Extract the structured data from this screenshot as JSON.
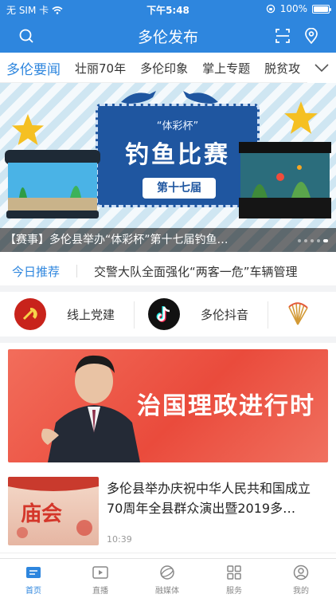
{
  "status_bar": {
    "carrier": "无 SIM 卡",
    "time": "下午5:48",
    "battery": "100%"
  },
  "header": {
    "title": "多伦发布"
  },
  "tabs": [
    {
      "label": "多伦要闻",
      "active": true
    },
    {
      "label": "壮丽70年"
    },
    {
      "label": "多伦印象"
    },
    {
      "label": "掌上专题"
    },
    {
      "label": "脱贫攻"
    }
  ],
  "banner": {
    "badge": "“体彩杯”",
    "headline": "钓鱼比赛",
    "edition": "第十七届",
    "caption": "【赛事】多伦县举办“体彩杯”第十七届钓鱼…",
    "dots": 5,
    "active_dot": 4
  },
  "today": {
    "tag": "今日推荐",
    "headline": "交警大队全面强化“两客一危”车辆管理"
  },
  "quick_links": [
    {
      "label": "线上党建",
      "icon": "party-emblem-icon"
    },
    {
      "label": "多伦抖音",
      "icon": "douyin-icon"
    },
    {
      "label": "",
      "icon": "fan-logo-icon"
    }
  ],
  "promo": {
    "text": "治国理政进行时"
  },
  "news": [
    {
      "thumb_text": "庙会",
      "title": "多伦县举办庆祝中华人民共和国成立70周年全县群众演出暨2019多…",
      "time": "10:39"
    }
  ],
  "tabbar": [
    {
      "label": "首页",
      "icon": "home-icon",
      "active": true
    },
    {
      "label": "直播",
      "icon": "play-icon"
    },
    {
      "label": "融媒体",
      "icon": "globe-icon"
    },
    {
      "label": "服务",
      "icon": "grid-icon"
    },
    {
      "label": "我的",
      "icon": "user-icon"
    }
  ],
  "colors": {
    "brand": "#2e86de",
    "promo": "#ea4b3c"
  }
}
